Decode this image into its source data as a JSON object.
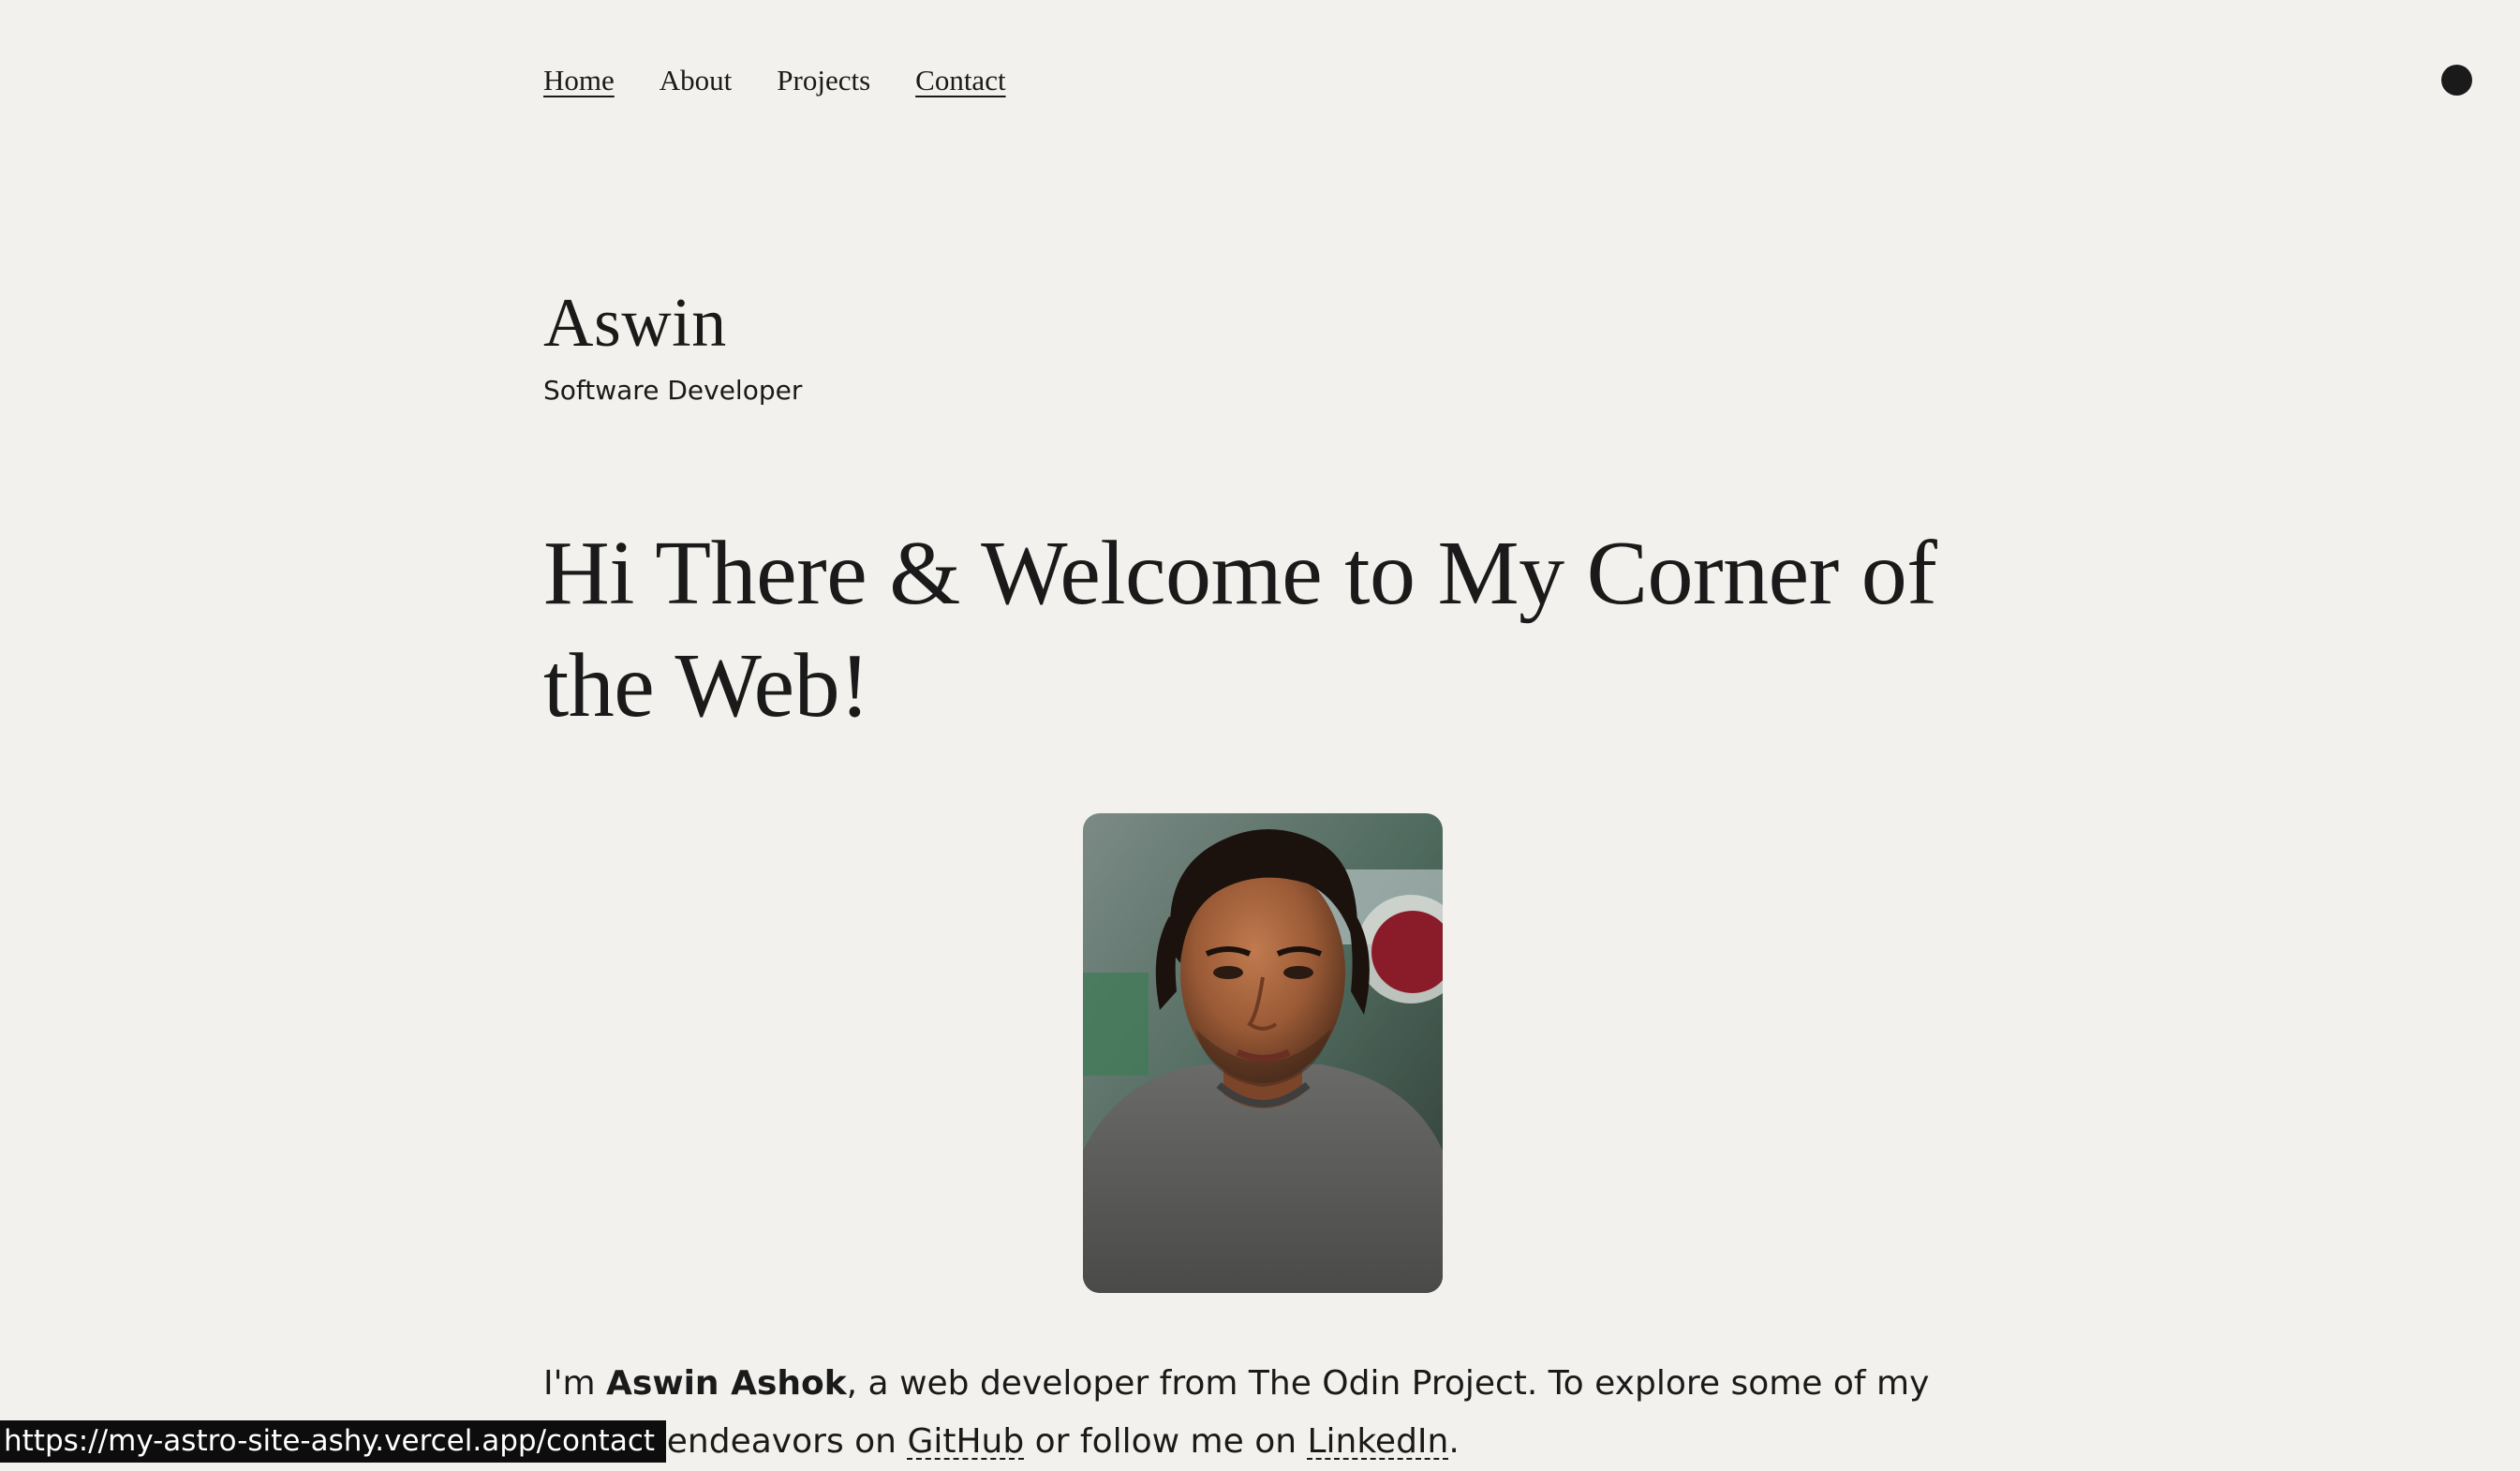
{
  "nav": {
    "items": [
      {
        "label": "Home"
      },
      {
        "label": "About"
      },
      {
        "label": "Projects"
      },
      {
        "label": "Contact"
      }
    ]
  },
  "theme_toggle": {
    "icon": "theme-toggle-circle-icon"
  },
  "header": {
    "title": "Aswin",
    "subtitle": "Software Developer"
  },
  "hero": {
    "heading": "Hi There & Welcome to My Corner of the Web!"
  },
  "profile": {
    "image": "profile-photo"
  },
  "intro": {
    "prefix": "I'm ",
    "name": "Aswin Ashok",
    "middle": ", a web developer from The Odin Project. To explore some of my coding endeavors on ",
    "github_label": "GitHub",
    "or_text": " or follow me on ",
    "linkedin_label": "LinkedIn",
    "suffix": "."
  },
  "status_bar": {
    "url": "https://my-astro-site-ashy.vercel.app/contact"
  },
  "colors": {
    "background": "#f2f1ed",
    "text": "#1a1a1a",
    "status_bar_bg": "#0d0d0d"
  }
}
